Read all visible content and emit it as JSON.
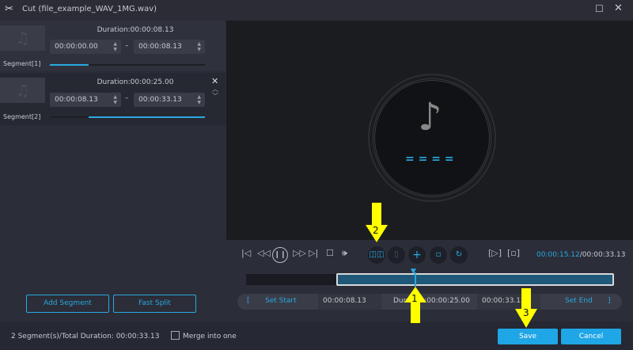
{
  "window": {
    "title": "Cut (file_example_WAV_1MG.wav)"
  },
  "segments": [
    {
      "label": "Segment[1]",
      "duration": "Duration:00:00:08.13",
      "start": "00:00:00.00",
      "end": "00:00:08.13",
      "range_start": 0.0,
      "range_end": 0.25
    },
    {
      "label": "Segment[2]",
      "duration": "Duration:00:00:25.00",
      "start": "00:00:08.13",
      "end": "00:00:33.13",
      "range_start": 0.25,
      "range_end": 1.0
    }
  ],
  "dash": "–",
  "buttons": {
    "add_segment": "Add Segment",
    "fast_split": "Fast Split",
    "save": "Save",
    "cancel": "Cancel"
  },
  "player": {
    "current": "00:00:15.12",
    "total": "/00:00:33.13",
    "playhead": 0.456,
    "wave": "= = = ="
  },
  "trim": {
    "set_start": "Set Start",
    "start": "00:00:08.13",
    "duration_label": "Duration:",
    "duration": "00:00:25.00",
    "end": "00:00:33.13",
    "set_end": "Set End",
    "open_bracket": "[",
    "close_bracket": "]"
  },
  "footer": {
    "summary": "2 Segment(s)/Total Duration: 00:00:33.13",
    "merge_label": "Merge into one",
    "merge_checked": false
  },
  "annotations": [
    "1",
    "2",
    "3"
  ],
  "colors": {
    "accent": "#29a8e0",
    "annotation": "#ffff00"
  }
}
